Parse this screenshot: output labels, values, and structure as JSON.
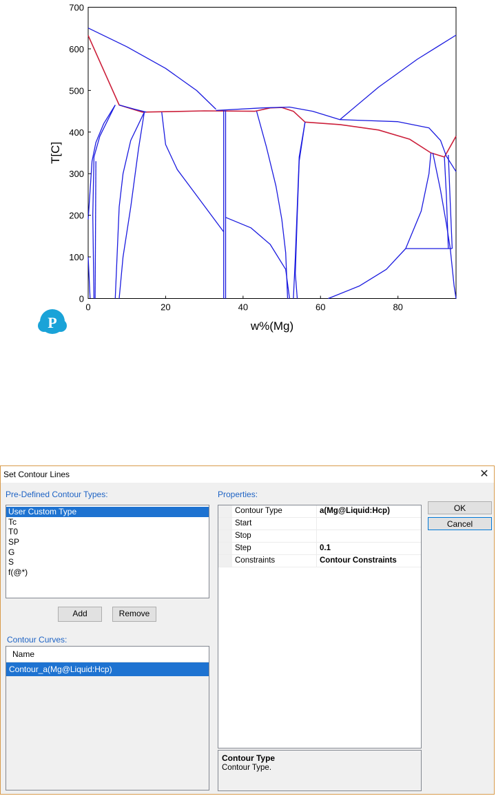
{
  "chart_data": {
    "type": "line",
    "title": "",
    "xlabel": "w%(Mg)",
    "ylabel": "T[C]",
    "xlim": [
      0,
      95
    ],
    "ylim": [
      0,
      700
    ],
    "xticks": [
      "0",
      "20",
      "40",
      "60",
      "80"
    ],
    "yticks": [
      "0",
      "100",
      "200",
      "300",
      "400",
      "500",
      "600",
      "700"
    ],
    "grid": false,
    "series": [
      {
        "color": "#cc1f3a",
        "points": [
          [
            0,
            632
          ],
          [
            8,
            465
          ],
          [
            14,
            448
          ],
          [
            20,
            449
          ],
          [
            30,
            451
          ],
          [
            43,
            450
          ],
          [
            47,
            458
          ],
          [
            50,
            459
          ],
          [
            53,
            450
          ],
          [
            56,
            424
          ],
          [
            65,
            418
          ],
          [
            75,
            405
          ],
          [
            83,
            383
          ],
          [
            88.5,
            350
          ],
          [
            92,
            340
          ],
          [
            95,
            390
          ]
        ]
      },
      {
        "color": "#1a1adf",
        "points": [
          [
            0,
            650
          ],
          [
            10,
            605
          ],
          [
            20,
            553
          ],
          [
            28,
            500
          ],
          [
            33,
            455
          ]
        ]
      },
      {
        "color": "#1a1adf",
        "points": [
          [
            65,
            430
          ],
          [
            75,
            508
          ],
          [
            85,
            575
          ],
          [
            95,
            633
          ]
        ]
      },
      {
        "color": "#1a1adf",
        "points": [
          [
            33,
            452
          ],
          [
            45,
            458
          ],
          [
            52,
            460
          ],
          [
            58,
            450
          ],
          [
            65,
            430
          ],
          [
            80,
            425
          ],
          [
            88,
            410
          ],
          [
            91,
            380
          ],
          [
            92.5,
            342
          ],
          [
            95,
            305
          ]
        ]
      },
      {
        "color": "#1a1adf",
        "points": [
          [
            8,
            465
          ],
          [
            12,
            455
          ],
          [
            15,
            448
          ]
        ]
      },
      {
        "color": "#1a1adf",
        "points": [
          [
            7,
            465
          ],
          [
            4,
            420
          ],
          [
            2,
            375
          ],
          [
            1,
            330
          ],
          [
            0.5,
            260
          ],
          [
            0,
            190
          ]
        ]
      },
      {
        "color": "#1a1adf",
        "points": [
          [
            7,
            465
          ],
          [
            3,
            390
          ],
          [
            1.5,
            340
          ],
          [
            1.2,
            200
          ],
          [
            1.5,
            0
          ]
        ]
      },
      {
        "color": "#1a1adf",
        "points": [
          [
            0,
            100
          ],
          [
            0.5,
            0
          ]
        ]
      },
      {
        "color": "#1a1adf",
        "points": [
          [
            2,
            330
          ],
          [
            1.8,
            0
          ]
        ]
      },
      {
        "color": "#1a1adf",
        "points": [
          [
            14.5,
            448
          ],
          [
            11,
            380
          ],
          [
            9,
            300
          ],
          [
            8,
            220
          ],
          [
            7,
            0
          ]
        ]
      },
      {
        "color": "#1a1adf",
        "points": [
          [
            14.5,
            448
          ],
          [
            13,
            360
          ],
          [
            11,
            220
          ],
          [
            9,
            100
          ],
          [
            8,
            0
          ]
        ]
      },
      {
        "color": "#1a1adf",
        "points": [
          [
            19,
            448
          ],
          [
            20,
            370
          ],
          [
            23,
            310
          ],
          [
            27,
            260
          ],
          [
            31,
            210
          ],
          [
            35,
            160
          ]
        ]
      },
      {
        "color": "#1a1adf",
        "points": [
          [
            35,
            452
          ],
          [
            35,
            0
          ]
        ]
      },
      {
        "color": "#1a1adf",
        "points": [
          [
            35.5,
            452
          ],
          [
            35.5,
            0
          ]
        ]
      },
      {
        "color": "#1a1adf",
        "points": [
          [
            35.5,
            195
          ],
          [
            42,
            170
          ],
          [
            47,
            130
          ],
          [
            51,
            70
          ]
        ]
      },
      {
        "color": "#1a1adf",
        "points": [
          [
            43.5,
            450
          ],
          [
            46,
            365
          ],
          [
            48.5,
            270
          ],
          [
            50,
            190
          ],
          [
            51,
            110
          ],
          [
            51.5,
            0
          ]
        ]
      },
      {
        "color": "#1a1adf",
        "points": [
          [
            51,
            70
          ],
          [
            52,
            0
          ]
        ]
      },
      {
        "color": "#1a1adf",
        "points": [
          [
            56,
            424
          ],
          [
            54.5,
            330
          ],
          [
            54,
            200
          ],
          [
            53.5,
            60
          ],
          [
            54,
            0
          ]
        ]
      },
      {
        "color": "#1a1adf",
        "points": [
          [
            53,
            0
          ],
          [
            53.5,
            100
          ],
          [
            54.5,
            340
          ],
          [
            56,
            424
          ]
        ]
      },
      {
        "color": "#1a1adf",
        "points": [
          [
            62,
            0
          ],
          [
            70,
            30
          ],
          [
            77,
            70
          ],
          [
            82,
            120
          ],
          [
            86,
            210
          ],
          [
            88,
            300
          ],
          [
            88.5,
            350
          ]
        ]
      },
      {
        "color": "#1a1adf",
        "points": [
          [
            82,
            120
          ],
          [
            94,
            120
          ]
        ]
      },
      {
        "color": "#1a1adf",
        "points": [
          [
            89,
            350
          ],
          [
            91,
            260
          ],
          [
            92.5,
            180
          ],
          [
            93.5,
            120
          ],
          [
            94.5,
            30
          ],
          [
            95,
            0
          ]
        ]
      },
      {
        "color": "#1a1adf",
        "points": [
          [
            92,
            340
          ],
          [
            92.5,
            250
          ],
          [
            93,
            120
          ]
        ]
      },
      {
        "color": "#1a1adf",
        "points": [
          [
            93,
            345
          ],
          [
            93.5,
            230
          ],
          [
            94,
            120
          ]
        ]
      }
    ]
  },
  "dialog": {
    "title": "Set Contour Lines",
    "close_glyph": "✕",
    "predefined_label": "Pre-Defined Contour Types:",
    "predefined_items": [
      "User Custom Type",
      "Tc",
      "T0",
      "SP",
      "G",
      "S",
      "f(@*)"
    ],
    "add_label": "Add",
    "remove_label": "Remove",
    "curves_label": "Contour Curves:",
    "curves_column": "Name",
    "curves_items": [
      "Contour_a(Mg@Liquid:Hcp)"
    ],
    "properties_label": "Properties:",
    "properties": [
      {
        "key": "Contour Type",
        "value": "a(Mg@Liquid:Hcp)"
      },
      {
        "key": "Start",
        "value": ""
      },
      {
        "key": "Stop",
        "value": ""
      },
      {
        "key": "Step",
        "value": "0.1"
      },
      {
        "key": "Constraints",
        "value": "Contour Constraints"
      }
    ],
    "help_title": "Contour Type",
    "help_text": "Contour Type.",
    "ok_label": "OK",
    "cancel_label": "Cancel"
  },
  "colors": {
    "accent": "#1c62c4",
    "selection": "#1e73d1",
    "solid_line": "#1a1adf",
    "liquidus_line": "#cc1f3a"
  },
  "logo": {
    "letter": "P"
  }
}
